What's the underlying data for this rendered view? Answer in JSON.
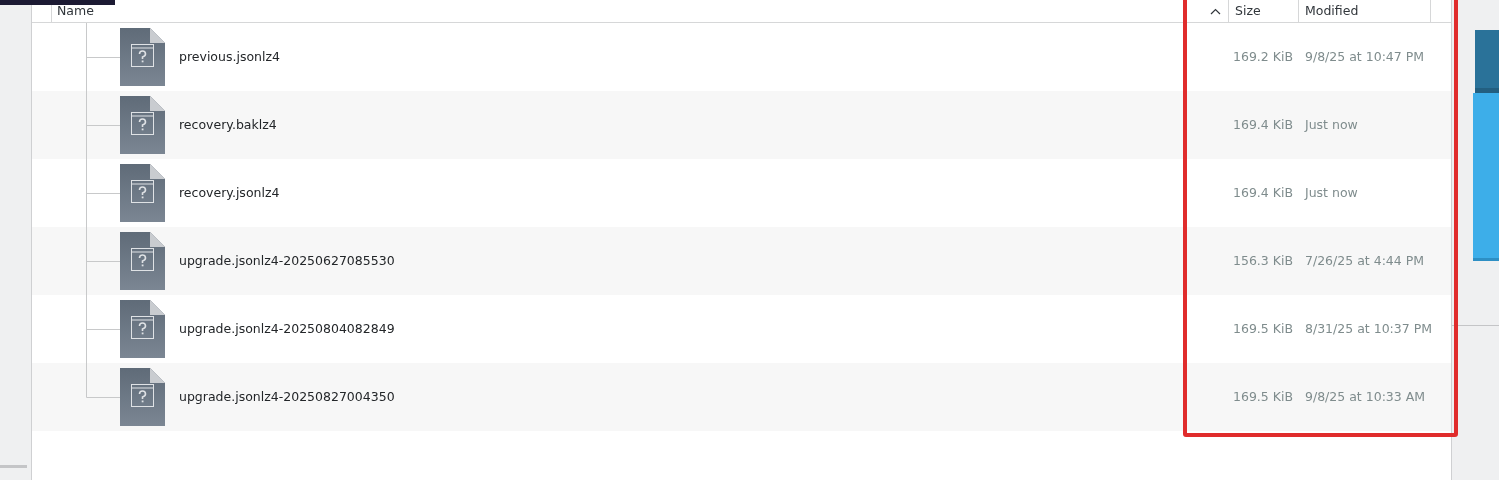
{
  "columns": [
    {
      "label": "Name",
      "sorted": true
    },
    {
      "label": "Size",
      "sorted": false
    },
    {
      "label": "Modified",
      "sorted": false
    }
  ],
  "files": [
    {
      "name": "previous.jsonlz4",
      "size": "169.2 KiB",
      "modified": "9/8/25 at 10:47 PM"
    },
    {
      "name": "recovery.baklz4",
      "size": "169.4 KiB",
      "modified": "Just now"
    },
    {
      "name": "recovery.jsonlz4",
      "size": "169.4 KiB",
      "modified": "Just now"
    },
    {
      "name": "upgrade.jsonlz4-20250627085530",
      "size": "156.3 KiB",
      "modified": "7/26/25 at 4:44 PM"
    },
    {
      "name": "upgrade.jsonlz4-20250804082849",
      "size": "169.5 KiB",
      "modified": "8/31/25 at 10:37 PM"
    },
    {
      "name": "upgrade.jsonlz4-20250827004350",
      "size": "169.5 KiB",
      "modified": "9/8/25 at 10:33 AM"
    }
  ]
}
